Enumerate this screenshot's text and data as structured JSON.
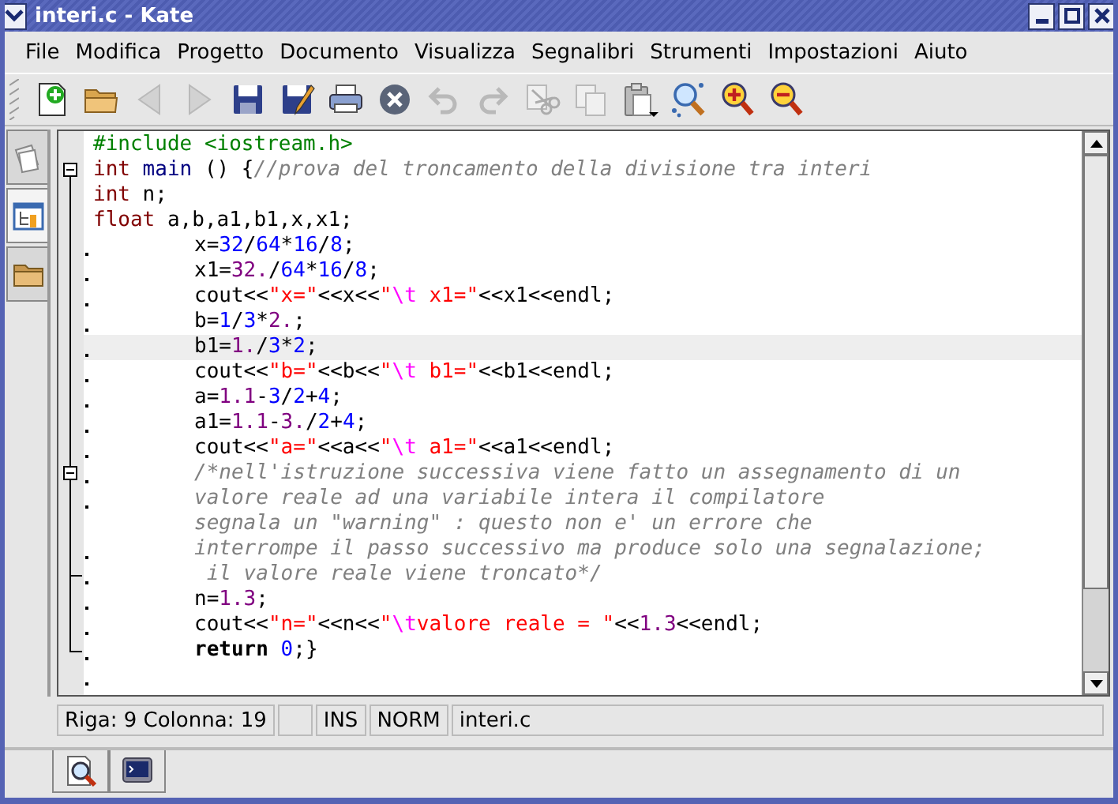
{
  "window": {
    "title": "interi.c - Kate"
  },
  "menu": [
    {
      "label": "File"
    },
    {
      "label": "Modifica"
    },
    {
      "label": "Progetto"
    },
    {
      "label": "Documento"
    },
    {
      "label": "Visualizza"
    },
    {
      "label": "Segnalibri"
    },
    {
      "label": "Strumenti"
    },
    {
      "label": "Impostazioni"
    },
    {
      "label": "Aiuto"
    }
  ],
  "toolbar": [
    {
      "kind": "new",
      "disabled": false
    },
    {
      "kind": "open",
      "disabled": false
    },
    {
      "kind": "back",
      "disabled": true
    },
    {
      "kind": "forward",
      "disabled": true
    },
    {
      "kind": "save",
      "disabled": false
    },
    {
      "kind": "saveas",
      "disabled": false
    },
    {
      "kind": "print",
      "disabled": false
    },
    {
      "kind": "close",
      "disabled": false
    },
    {
      "kind": "undo",
      "disabled": true
    },
    {
      "kind": "redo",
      "disabled": true
    },
    {
      "kind": "cut",
      "disabled": true
    },
    {
      "kind": "copy",
      "disabled": true
    },
    {
      "kind": "paste",
      "disabled": false
    },
    {
      "kind": "find",
      "disabled": false
    },
    {
      "kind": "zoomin",
      "disabled": false
    },
    {
      "kind": "zoomout",
      "disabled": false
    }
  ],
  "sidebar_tabs": [
    {
      "kind": "documents",
      "selected": false
    },
    {
      "kind": "tree",
      "selected": true
    },
    {
      "kind": "folder",
      "selected": false
    }
  ],
  "editor": {
    "lines": [
      {
        "marker": false,
        "indent": false,
        "fold_start": false,
        "fold_end": false,
        "current": false,
        "segs": [
          {
            "text": "#include <iostream.h>",
            "kind": "preproc"
          }
        ]
      },
      {
        "marker": false,
        "indent": false,
        "fold_start": true,
        "fold_end": false,
        "current": false,
        "segs": [
          {
            "text": "int",
            "kind": "type"
          },
          {
            "text": " main",
            "kind": "func"
          },
          {
            "text": " () {",
            "kind": "plain"
          },
          {
            "text": "//prova del troncamento della divisione tra interi",
            "kind": "comment"
          }
        ]
      },
      {
        "marker": false,
        "indent": false,
        "fold_start": false,
        "fold_end": false,
        "current": false,
        "segs": [
          {
            "text": "int",
            "kind": "type"
          },
          {
            "text": " n;",
            "kind": "plain"
          }
        ]
      },
      {
        "marker": false,
        "indent": false,
        "fold_start": false,
        "fold_end": false,
        "current": false,
        "segs": [
          {
            "text": "float",
            "kind": "type"
          },
          {
            "text": " a,b,a1,b1,x,x1;",
            "kind": "plain"
          }
        ]
      },
      {
        "marker": true,
        "indent": true,
        "fold_start": false,
        "fold_end": false,
        "current": false,
        "segs": [
          {
            "text": "x=",
            "kind": "plain"
          },
          {
            "text": "32",
            "kind": "number"
          },
          {
            "text": "/",
            "kind": "plain"
          },
          {
            "text": "64",
            "kind": "number"
          },
          {
            "text": "*",
            "kind": "plain"
          },
          {
            "text": "16",
            "kind": "number"
          },
          {
            "text": "/",
            "kind": "plain"
          },
          {
            "text": "8",
            "kind": "number"
          },
          {
            "text": ";",
            "kind": "plain"
          }
        ]
      },
      {
        "marker": true,
        "indent": true,
        "fold_start": false,
        "fold_end": false,
        "current": false,
        "segs": [
          {
            "text": "x1=",
            "kind": "plain"
          },
          {
            "text": "32.",
            "kind": "float"
          },
          {
            "text": "/",
            "kind": "plain"
          },
          {
            "text": "64",
            "kind": "number"
          },
          {
            "text": "*",
            "kind": "plain"
          },
          {
            "text": "16",
            "kind": "number"
          },
          {
            "text": "/",
            "kind": "plain"
          },
          {
            "text": "8",
            "kind": "number"
          },
          {
            "text": ";",
            "kind": "plain"
          }
        ]
      },
      {
        "marker": true,
        "indent": true,
        "fold_start": false,
        "fold_end": false,
        "current": false,
        "segs": [
          {
            "text": "cout<<",
            "kind": "plain"
          },
          {
            "text": "\"x=\"",
            "kind": "string"
          },
          {
            "text": "<<x<<",
            "kind": "plain"
          },
          {
            "text": "\"",
            "kind": "string"
          },
          {
            "text": "\\t",
            "kind": "escape"
          },
          {
            "text": " x1=\"",
            "kind": "string"
          },
          {
            "text": "<<x1<<endl;",
            "kind": "plain"
          }
        ]
      },
      {
        "marker": true,
        "indent": true,
        "fold_start": false,
        "fold_end": false,
        "current": false,
        "segs": [
          {
            "text": "b=",
            "kind": "plain"
          },
          {
            "text": "1",
            "kind": "number"
          },
          {
            "text": "/",
            "kind": "plain"
          },
          {
            "text": "3",
            "kind": "number"
          },
          {
            "text": "*",
            "kind": "plain"
          },
          {
            "text": "2.",
            "kind": "float"
          },
          {
            "text": ";",
            "kind": "plain"
          }
        ]
      },
      {
        "marker": true,
        "indent": true,
        "fold_start": false,
        "fold_end": false,
        "current": true,
        "segs": [
          {
            "text": "b1=",
            "kind": "plain"
          },
          {
            "text": "1.",
            "kind": "float"
          },
          {
            "text": "/",
            "kind": "plain"
          },
          {
            "text": "3",
            "kind": "number"
          },
          {
            "text": "*",
            "kind": "plain"
          },
          {
            "text": "2",
            "kind": "number"
          },
          {
            "text": ";",
            "kind": "plain"
          }
        ]
      },
      {
        "marker": true,
        "indent": true,
        "fold_start": false,
        "fold_end": false,
        "current": false,
        "segs": [
          {
            "text": "cout<<",
            "kind": "plain"
          },
          {
            "text": "\"b=\"",
            "kind": "string"
          },
          {
            "text": "<<b<<",
            "kind": "plain"
          },
          {
            "text": "\"",
            "kind": "string"
          },
          {
            "text": "\\t",
            "kind": "escape"
          },
          {
            "text": " b1=\"",
            "kind": "string"
          },
          {
            "text": "<<b1<<endl;",
            "kind": "plain"
          }
        ]
      },
      {
        "marker": true,
        "indent": true,
        "fold_start": false,
        "fold_end": false,
        "current": false,
        "segs": [
          {
            "text": "a=",
            "kind": "plain"
          },
          {
            "text": "1.1",
            "kind": "float"
          },
          {
            "text": "-",
            "kind": "plain"
          },
          {
            "text": "3",
            "kind": "number"
          },
          {
            "text": "/",
            "kind": "plain"
          },
          {
            "text": "2",
            "kind": "number"
          },
          {
            "text": "+",
            "kind": "plain"
          },
          {
            "text": "4",
            "kind": "number"
          },
          {
            "text": ";",
            "kind": "plain"
          }
        ]
      },
      {
        "marker": true,
        "indent": true,
        "fold_start": false,
        "fold_end": false,
        "current": false,
        "segs": [
          {
            "text": "a1=",
            "kind": "plain"
          },
          {
            "text": "1.1",
            "kind": "float"
          },
          {
            "text": "-",
            "kind": "plain"
          },
          {
            "text": "3.",
            "kind": "float"
          },
          {
            "text": "/",
            "kind": "plain"
          },
          {
            "text": "2",
            "kind": "number"
          },
          {
            "text": "+",
            "kind": "plain"
          },
          {
            "text": "4",
            "kind": "number"
          },
          {
            "text": ";",
            "kind": "plain"
          }
        ]
      },
      {
        "marker": true,
        "indent": true,
        "fold_start": false,
        "fold_end": false,
        "current": false,
        "segs": [
          {
            "text": "cout<<",
            "kind": "plain"
          },
          {
            "text": "\"a=\"",
            "kind": "string"
          },
          {
            "text": "<<a<<",
            "kind": "plain"
          },
          {
            "text": "\"",
            "kind": "string"
          },
          {
            "text": "\\t",
            "kind": "escape"
          },
          {
            "text": " a1=\"",
            "kind": "string"
          },
          {
            "text": "<<a1<<endl;",
            "kind": "plain"
          }
        ]
      },
      {
        "marker": true,
        "indent": true,
        "fold_start": true,
        "fold_end": false,
        "current": false,
        "segs": [
          {
            "text": "/*nell'istruzione successiva viene fatto un assegnamento di un",
            "kind": "comment"
          }
        ]
      },
      {
        "marker": true,
        "indent": true,
        "fold_start": false,
        "fold_end": false,
        "current": false,
        "segs": [
          {
            "text": "valore reale ad una variabile intera il compilatore",
            "kind": "comment"
          }
        ]
      },
      {
        "marker": false,
        "indent": true,
        "fold_start": false,
        "fold_end": false,
        "current": false,
        "segs": [
          {
            "text": "segnala un \"warning\" : questo non e' un errore che",
            "kind": "comment"
          }
        ]
      },
      {
        "marker": true,
        "indent": true,
        "fold_start": false,
        "fold_end": false,
        "current": false,
        "segs": [
          {
            "text": "interrompe il passo successivo ma produce solo una segnalazione;",
            "kind": "comment"
          }
        ]
      },
      {
        "marker": true,
        "indent": true,
        "fold_start": false,
        "fold_end": true,
        "current": false,
        "segs": [
          {
            "text": " il valore reale viene troncato*/",
            "kind": "comment"
          }
        ]
      },
      {
        "marker": true,
        "indent": true,
        "fold_start": false,
        "fold_end": false,
        "current": false,
        "segs": [
          {
            "text": "n=",
            "kind": "plain"
          },
          {
            "text": "1.3",
            "kind": "float"
          },
          {
            "text": ";",
            "kind": "plain"
          }
        ]
      },
      {
        "marker": true,
        "indent": true,
        "fold_start": false,
        "fold_end": false,
        "current": false,
        "segs": [
          {
            "text": "cout<<",
            "kind": "plain"
          },
          {
            "text": "\"n=\"",
            "kind": "string"
          },
          {
            "text": "<<n<<",
            "kind": "plain"
          },
          {
            "text": "\"",
            "kind": "string"
          },
          {
            "text": "\\t",
            "kind": "escape"
          },
          {
            "text": "valore reale = \"",
            "kind": "string"
          },
          {
            "text": "<<",
            "kind": "plain"
          },
          {
            "text": "1.3",
            "kind": "float"
          },
          {
            "text": "<<endl;",
            "kind": "plain"
          }
        ]
      },
      {
        "marker": true,
        "indent": true,
        "fold_start": false,
        "fold_end": true,
        "current": false,
        "segs": [
          {
            "text": "return",
            "kind": "keyword"
          },
          {
            "text": " 0",
            "kind": "number"
          },
          {
            "text": ";}",
            "kind": "plain"
          }
        ]
      },
      {
        "marker": true,
        "indent": false,
        "fold_start": false,
        "fold_end": false,
        "current": false
      }
    ]
  },
  "status_bar": [
    "Riga: 9 Colonna: 19",
    "INS",
    "NORM",
    "interi.c"
  ],
  "bottom_tabs": [
    {
      "kind": "find-in-files"
    },
    {
      "kind": "terminal"
    }
  ]
}
